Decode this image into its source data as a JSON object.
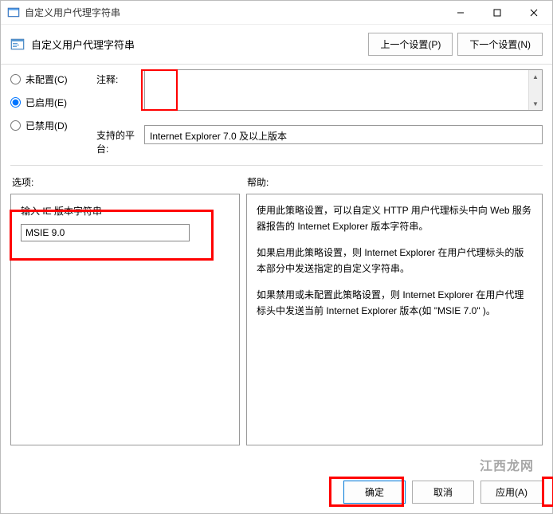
{
  "titlebar": {
    "title": "自定义用户代理字符串"
  },
  "header": {
    "title": "自定义用户代理字符串",
    "prev_button": "上一个设置(P)",
    "next_button": "下一个设置(N)"
  },
  "radios": {
    "not_configured": "未配置(C)",
    "enabled": "已启用(E)",
    "disabled": "已禁用(D)",
    "selected": "enabled"
  },
  "fields": {
    "comment_label": "注释:",
    "comment_value": "",
    "platform_label": "支持的平台:",
    "platform_value": "Internet Explorer 7.0 及以上版本"
  },
  "sections": {
    "options_label": "选项:",
    "help_label": "帮助:"
  },
  "options": {
    "input_label": "输入 IE 版本字符串",
    "input_value": "MSIE 9.0"
  },
  "help": {
    "p1": "使用此策略设置，可以自定义 HTTP 用户代理标头中向 Web 服务器报告的 Internet Explorer 版本字符串。",
    "p2": "如果启用此策略设置，则 Internet Explorer 在用户代理标头的版本部分中发送指定的自定义字符串。",
    "p3": "如果禁用或未配置此策略设置，则 Internet Explorer 在用户代理标头中发送当前 Internet Explorer 版本(如 \"MSIE 7.0\" )。"
  },
  "footer": {
    "ok": "确定",
    "cancel": "取消",
    "apply": "应用(A)"
  },
  "watermark": "江西龙网"
}
